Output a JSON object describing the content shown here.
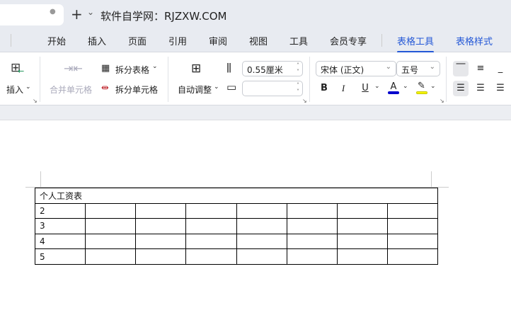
{
  "titlebar": {
    "add": "+",
    "dropdown": "⌄",
    "title": "软件自学网：RJZXW.COM"
  },
  "tabs": [
    {
      "label": "开始"
    },
    {
      "label": "插入"
    },
    {
      "label": "页面"
    },
    {
      "label": "引用"
    },
    {
      "label": "审阅"
    },
    {
      "label": "视图"
    },
    {
      "label": "工具"
    },
    {
      "label": "会员专享"
    },
    {
      "label": "表格工具"
    },
    {
      "label": "表格样式"
    }
  ],
  "ribbon": {
    "insert": "插入",
    "merge_cells": "合并单元格",
    "split_table": "拆分表格",
    "split_cells": "拆分单元格",
    "autofit": "自动调整",
    "row_height": "0.55厘米",
    "col_width": "",
    "font_name": "宋体 (正文)",
    "font_size": "五号",
    "bold": "B",
    "italic": "I",
    "underline": "U",
    "font_color": "A",
    "font_color_hex": "#0000cc",
    "highlight_hex": "#f5f500"
  },
  "table": {
    "title": "个人工资表",
    "rows": [
      "2",
      "3",
      "4",
      "5"
    ]
  }
}
